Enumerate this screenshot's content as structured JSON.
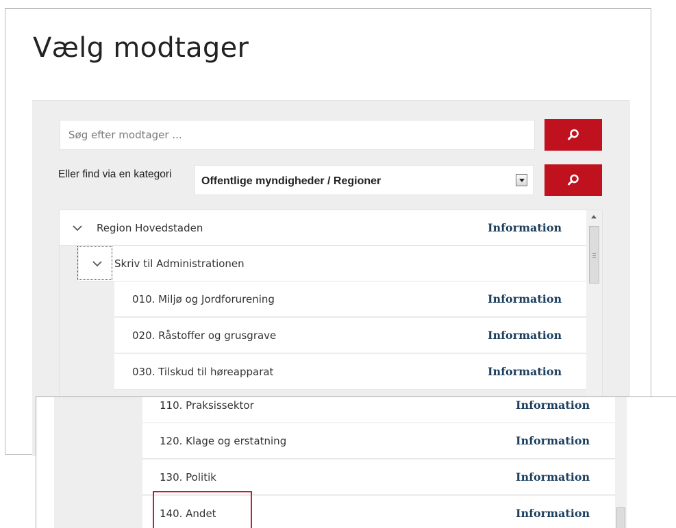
{
  "page": {
    "title": "Vælg modtager"
  },
  "search": {
    "placeholder": "Søg efter modtager ..."
  },
  "category": {
    "label": "Eller find via en kategori",
    "selected": "Offentlige myndigheder / Regioner"
  },
  "list": {
    "region": {
      "label": "Region Hovedstaden",
      "info": "Information"
    },
    "group": {
      "label": "Skriv til Administrationen"
    },
    "items": [
      {
        "label": "010. Miljø og Jordforurening",
        "info": "Information"
      },
      {
        "label": "020. Råstoffer og grusgrave",
        "info": "Information"
      },
      {
        "label": "030. Tilskud til høreapparat",
        "info": "Information"
      }
    ]
  },
  "inset": {
    "items": [
      {
        "label": "110. Praksissektor",
        "info": "Information"
      },
      {
        "label": "120. Klage og erstatning",
        "info": "Information"
      },
      {
        "label": "130. Politik",
        "info": "Information"
      },
      {
        "label": "140. Andet",
        "info": "Information"
      }
    ]
  },
  "colors": {
    "accent_red": "#c0121e",
    "link_blue": "#1d3f5e",
    "highlight": "#c0203a"
  }
}
